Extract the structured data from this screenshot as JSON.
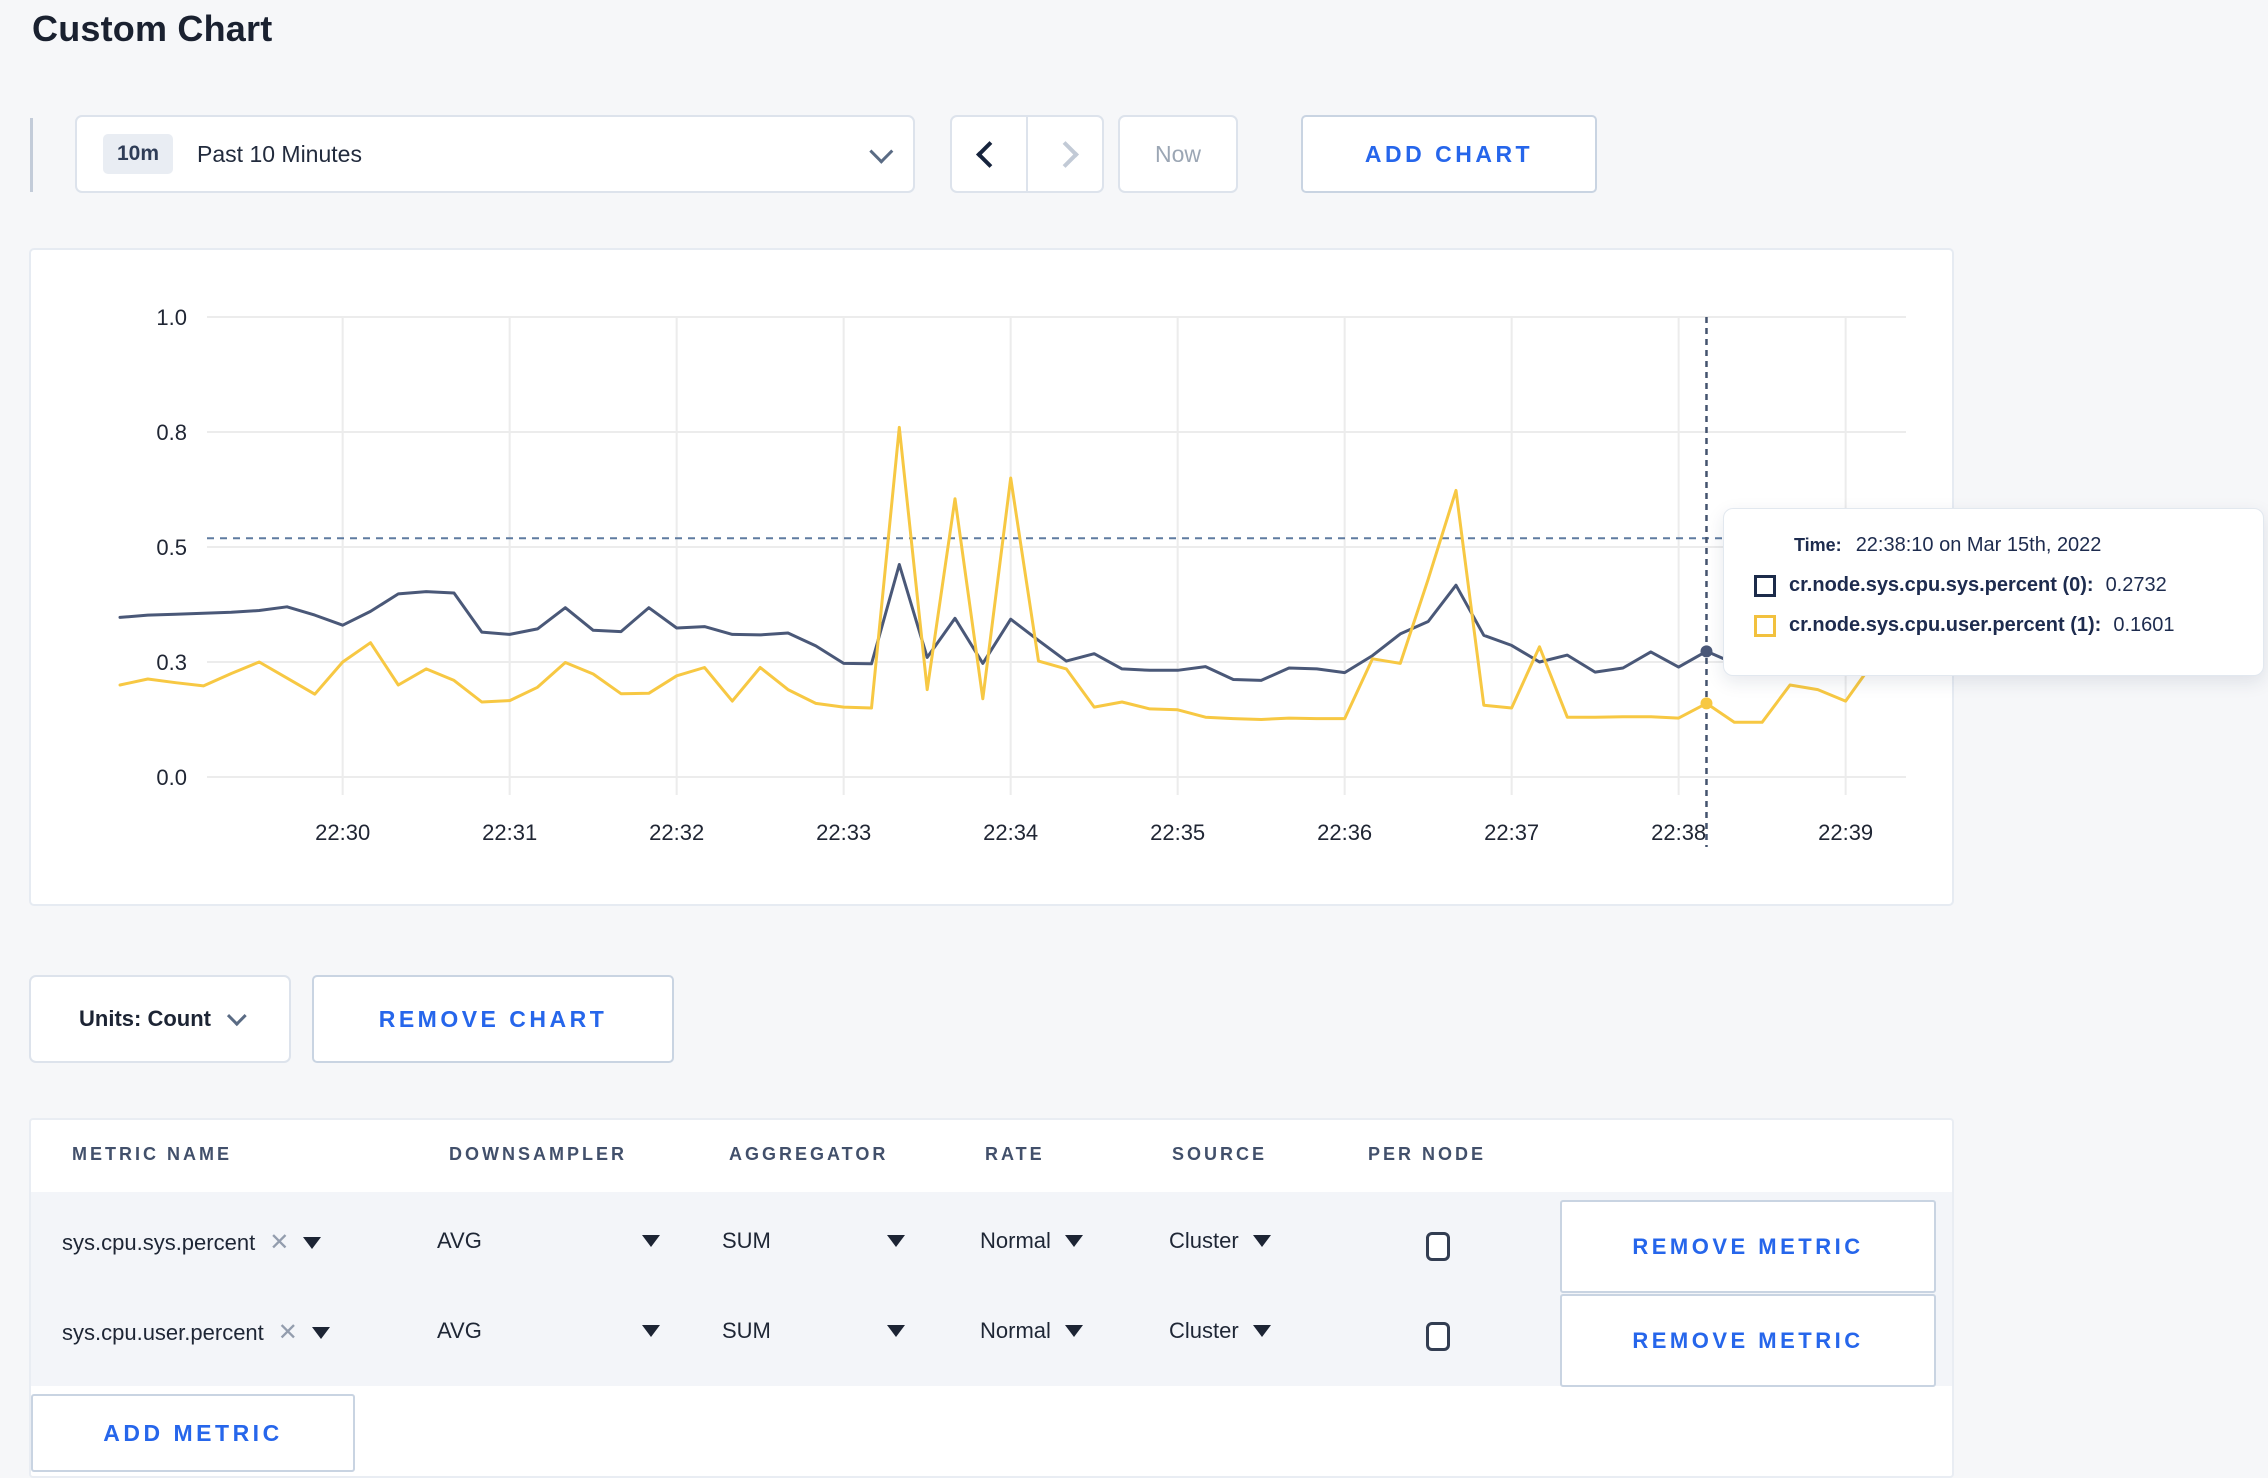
{
  "page": {
    "title": "Custom Chart"
  },
  "toolbar": {
    "time_window_badge": "10m",
    "time_window_label": "Past 10 Minutes",
    "now_label": "Now",
    "add_chart_label": "ADD CHART"
  },
  "units": {
    "label": "Units: Count"
  },
  "remove_chart_label": "REMOVE CHART",
  "tooltip": {
    "time_label": "Time:",
    "time_value": "22:38:10 on Mar 15th, 2022",
    "series": [
      {
        "label": "cr.node.sys.cpu.sys.percent (0):",
        "value": "0.2732",
        "color": "#1c2b4a"
      },
      {
        "label": "cr.node.sys.cpu.user.percent (1):",
        "value": "0.1601",
        "color": "#f2c13e"
      }
    ]
  },
  "chart_data": {
    "type": "line",
    "title": "",
    "xlabel": "",
    "ylabel": "",
    "x_start": "22:28:40",
    "x_step_seconds": 10,
    "x_tick_labels": [
      "22:30",
      "22:31",
      "22:32",
      "22:33",
      "22:34",
      "22:35",
      "22:36",
      "22:37",
      "22:38",
      "22:39"
    ],
    "y_ticks": {
      "labels": [
        "0.0",
        "0.3",
        "0.5",
        "0.8",
        "1.0"
      ],
      "values": [
        0,
        0.25,
        0.5,
        0.75,
        1.0
      ]
    },
    "ylim": [
      0,
      1.0
    ],
    "grid": true,
    "dashed_reference_value": 0.519,
    "crosshair_index": 57,
    "crosshair_time": "22:38:10",
    "series": [
      {
        "name": "cr.node.sys.cpu.sys.percent (0)",
        "color": "#4a5878",
        "hover_value": 0.2732,
        "values": [
          0.347,
          0.352,
          0.354,
          0.356,
          0.358,
          0.362,
          0.37,
          0.352,
          0.33,
          0.36,
          0.398,
          0.403,
          0.4,
          0.315,
          0.31,
          0.322,
          0.368,
          0.319,
          0.316,
          0.368,
          0.324,
          0.327,
          0.31,
          0.309,
          0.313,
          0.285,
          0.247,
          0.246,
          0.462,
          0.26,
          0.345,
          0.247,
          0.343,
          0.297,
          0.252,
          0.268,
          0.235,
          0.232,
          0.232,
          0.24,
          0.212,
          0.21,
          0.237,
          0.235,
          0.227,
          0.264,
          0.311,
          0.338,
          0.417,
          0.308,
          0.286,
          0.25,
          0.265,
          0.228,
          0.237,
          0.272,
          0.239,
          0.2732,
          0.247,
          0.25,
          0.252,
          0.255,
          0.29,
          0.31
        ]
      },
      {
        "name": "cr.node.sys.cpu.user.percent (1)",
        "color": "#f7c843",
        "hover_value": 0.1601,
        "values": [
          0.2,
          0.213,
          0.205,
          0.198,
          0.225,
          0.25,
          0.215,
          0.18,
          0.25,
          0.292,
          0.2,
          0.235,
          0.21,
          0.163,
          0.166,
          0.195,
          0.249,
          0.224,
          0.181,
          0.182,
          0.22,
          0.238,
          0.165,
          0.238,
          0.19,
          0.16,
          0.152,
          0.15,
          0.76,
          0.19,
          0.605,
          0.17,
          0.65,
          0.252,
          0.235,
          0.152,
          0.163,
          0.148,
          0.146,
          0.13,
          0.127,
          0.125,
          0.128,
          0.127,
          0.127,
          0.257,
          0.247,
          0.43,
          0.623,
          0.156,
          0.15,
          0.283,
          0.13,
          0.13,
          0.131,
          0.131,
          0.128,
          0.1601,
          0.119,
          0.119,
          0.2,
          0.19,
          0.165,
          0.25
        ]
      }
    ]
  },
  "metrics_table": {
    "columns": [
      "METRIC NAME",
      "DOWNSAMPLER",
      "AGGREGATOR",
      "RATE",
      "SOURCE",
      "PER NODE"
    ],
    "rows": [
      {
        "metric": "sys.cpu.sys.percent",
        "downsampler": "AVG",
        "aggregator": "SUM",
        "rate": "Normal",
        "source": "Cluster",
        "per_node_checked": false,
        "remove_label": "REMOVE METRIC"
      },
      {
        "metric": "sys.cpu.user.percent",
        "downsampler": "AVG",
        "aggregator": "SUM",
        "rate": "Normal",
        "source": "Cluster",
        "per_node_checked": false,
        "remove_label": "REMOVE METRIC"
      }
    ],
    "remove_x": "✕",
    "add_metric_label": "ADD METRIC"
  }
}
